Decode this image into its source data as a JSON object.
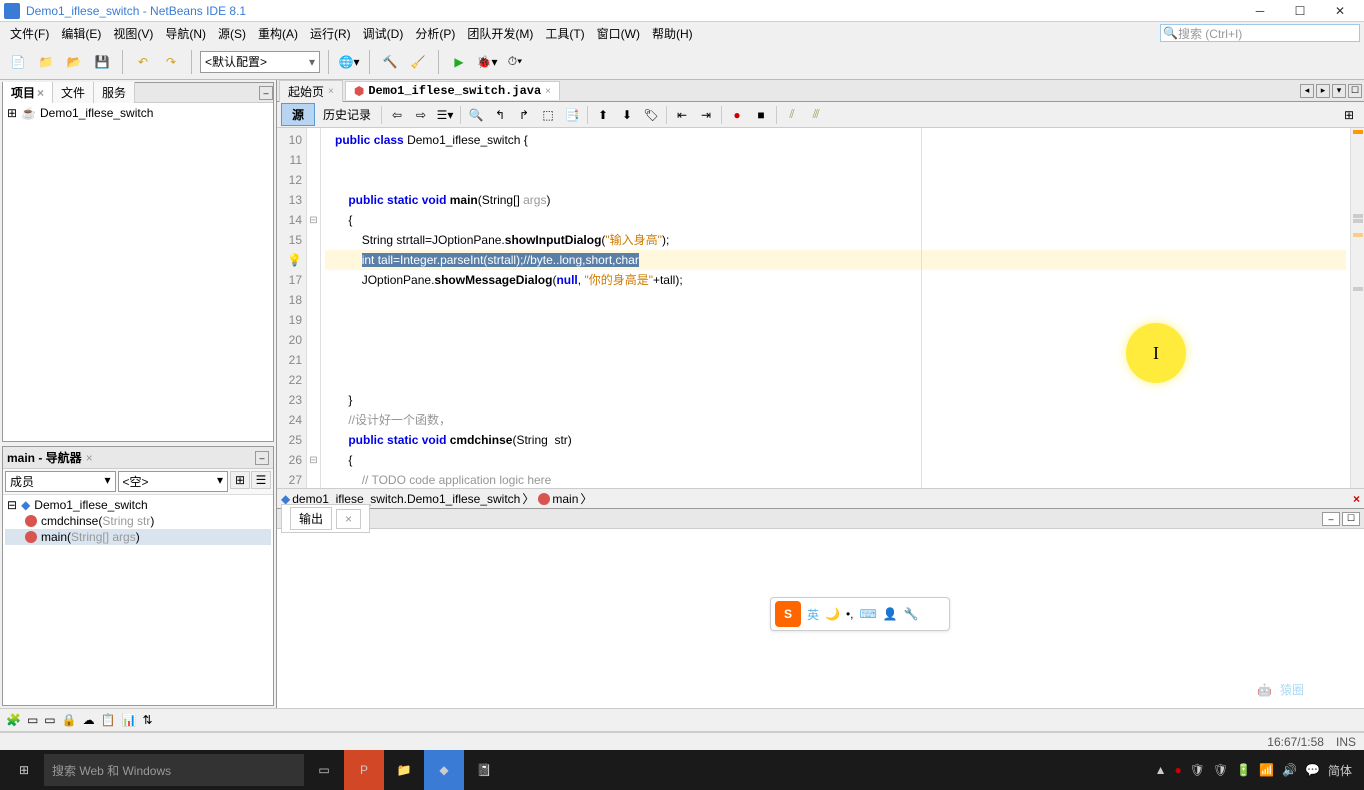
{
  "window": {
    "title": "Demo1_iflese_switch - NetBeans IDE 8.1"
  },
  "menu": {
    "items": [
      "文件(F)",
      "编辑(E)",
      "视图(V)",
      "导航(N)",
      "源(S)",
      "重构(A)",
      "运行(R)",
      "调试(D)",
      "分析(P)",
      "团队开发(M)",
      "工具(T)",
      "窗口(W)",
      "帮助(H)"
    ]
  },
  "search": {
    "placeholder": "搜索 (Ctrl+I)"
  },
  "config": {
    "label": "<默认配置>"
  },
  "tabs": {
    "project": "项目",
    "file": "文件",
    "service": "服务"
  },
  "projectTree": {
    "root": "Demo1_iflese_switch"
  },
  "navigator": {
    "title": "main - 导航器",
    "members": "成员",
    "empty": "<空>",
    "class": "Demo1_iflese_switch",
    "methods": [
      "cmdchinse(String str)",
      "main(String[] args)"
    ]
  },
  "editorTabs": {
    "start": "起始页",
    "file": "Demo1_iflese_switch.java"
  },
  "editorBar": {
    "source": "源",
    "history": "历史记录"
  },
  "breadcrumb": {
    "pkg": "demo1_iflese_switch.Demo1_iflese_switch",
    "method": "main"
  },
  "output": {
    "title": "输出"
  },
  "statusbar": {
    "pos": "16:67/1:58",
    "ins": "INS"
  },
  "taskbar": {
    "search": "搜索 Web 和 Windows",
    "lang": "简体"
  },
  "code": {
    "l10": {
      "public": "public",
      "class": "class",
      "name": " Demo1_iflese_switch {"
    },
    "l13": {
      "public": "public",
      "static": "static",
      "void": "void",
      "main": "main",
      "args": "args",
      "rest": ")"
    },
    "l14": {
      "brace": "{"
    },
    "l15": {
      "t1": "String strtall=JOptionPane.",
      "m": "showInputDialog",
      "t2": "(",
      "s": "\"输入身高\"",
      "t3": ");"
    },
    "l16": {
      "sel": "int tall=Integer.parseInt(strtall);//byte..long,short,char"
    },
    "l17": {
      "t1": "JOptionPane.",
      "m": "showMessageDialog",
      "t2": "(",
      "kw": "null",
      "t3": ", ",
      "s": "\"你的身高是\"",
      "t4": "+tall);"
    },
    "l23": {
      "brace": "}"
    },
    "l24": {
      "c": "//设计好一个函数，"
    },
    "l25": {
      "public": "public",
      "static": "static",
      "void": "void",
      "mn": "cmdchinse",
      "t": "(String  str)"
    },
    "l26": {
      "brace": "{"
    },
    "l27": {
      "c": "// TODO code application logic here"
    }
  },
  "chart_data": null
}
